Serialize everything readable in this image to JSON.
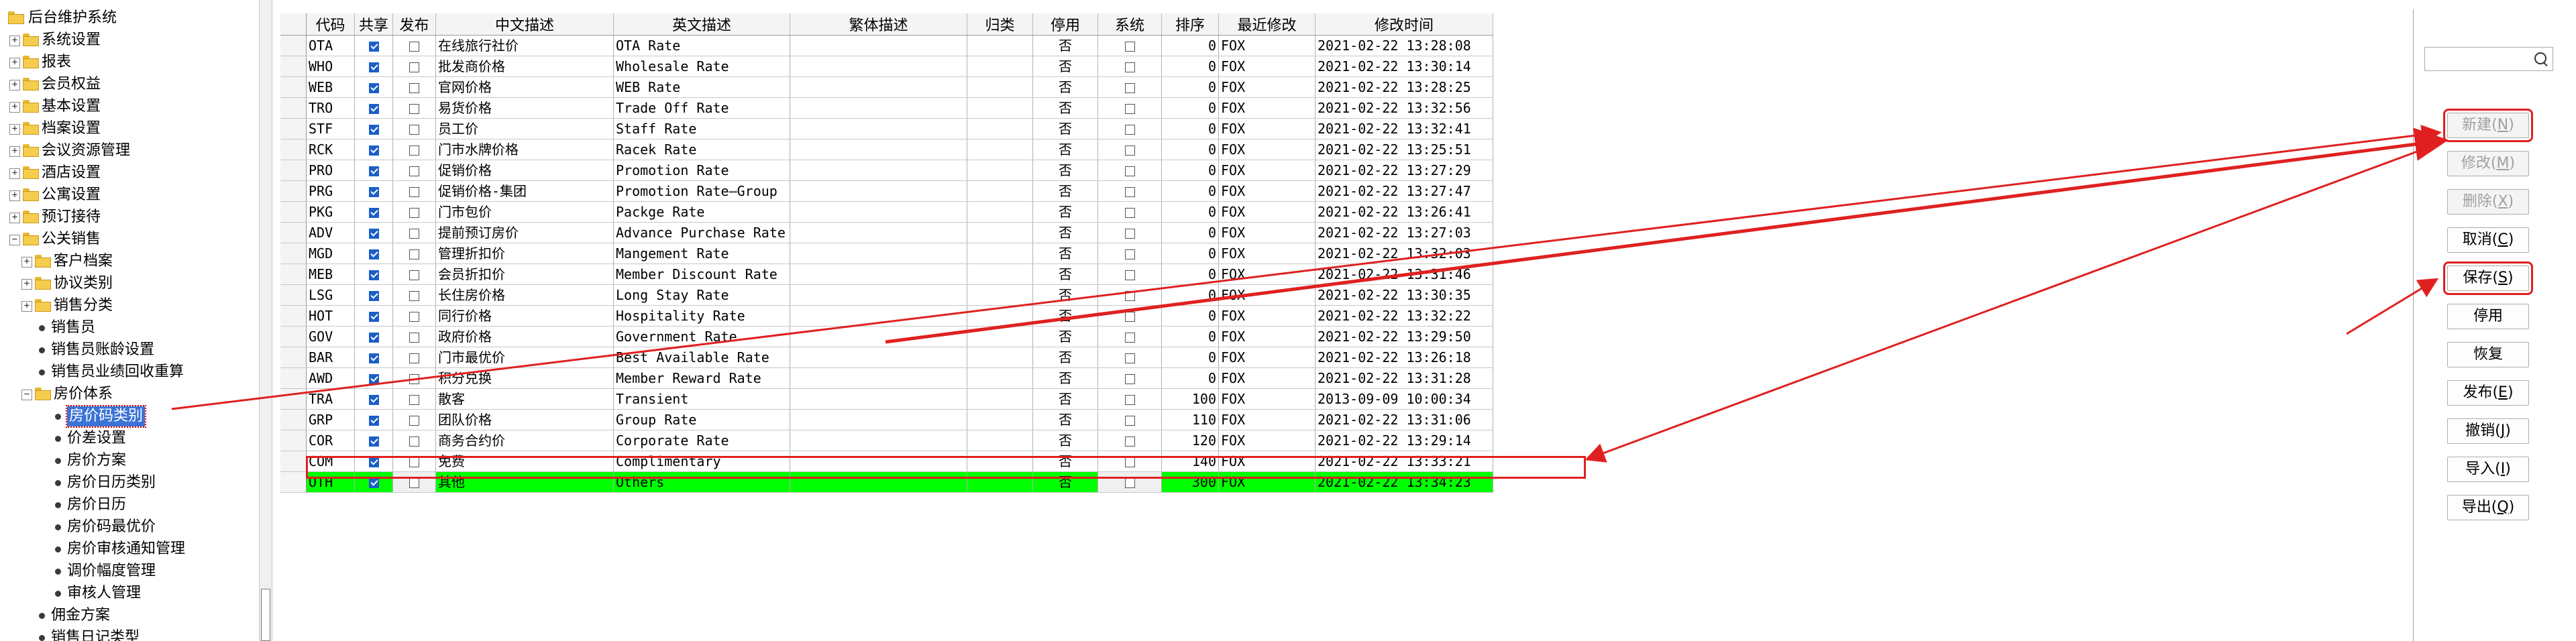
{
  "tree": {
    "items": [
      {
        "label": "后台维护系统",
        "level": 0,
        "type": "folder",
        "expander": ""
      },
      {
        "label": "系统设置",
        "level": 1,
        "type": "folder",
        "expander": "+"
      },
      {
        "label": "报表",
        "level": 1,
        "type": "folder",
        "expander": "+"
      },
      {
        "label": "会员权益",
        "level": 1,
        "type": "folder",
        "expander": "+"
      },
      {
        "label": "基本设置",
        "level": 1,
        "type": "folder",
        "expander": "+"
      },
      {
        "label": "档案设置",
        "level": 1,
        "type": "folder",
        "expander": "+"
      },
      {
        "label": "会议资源管理",
        "level": 1,
        "type": "folder",
        "expander": "+"
      },
      {
        "label": "酒店设置",
        "level": 1,
        "type": "folder",
        "expander": "+"
      },
      {
        "label": "公寓设置",
        "level": 1,
        "type": "folder",
        "expander": "+"
      },
      {
        "label": "预订接待",
        "level": 1,
        "type": "folder",
        "expander": "+"
      },
      {
        "label": "公关销售",
        "level": 1,
        "type": "folder",
        "expander": "-"
      },
      {
        "label": "客户档案",
        "level": 2,
        "type": "folder",
        "expander": "+"
      },
      {
        "label": "协议类别",
        "level": 2,
        "type": "folder",
        "expander": "+"
      },
      {
        "label": "销售分类",
        "level": 2,
        "type": "folder",
        "expander": "+"
      },
      {
        "label": "销售员",
        "level": 2,
        "type": "leaf",
        "expander": ""
      },
      {
        "label": "销售员账龄设置",
        "level": 2,
        "type": "leaf",
        "expander": ""
      },
      {
        "label": "销售员业绩回收重算",
        "level": 2,
        "type": "leaf",
        "expander": ""
      },
      {
        "label": "房价体系",
        "level": 2,
        "type": "folder",
        "expander": "-"
      },
      {
        "label": "房价码类别",
        "level": 3,
        "type": "leaf",
        "expander": "",
        "selected": true
      },
      {
        "label": "价差设置",
        "level": 3,
        "type": "leaf",
        "expander": ""
      },
      {
        "label": "房价方案",
        "level": 3,
        "type": "leaf",
        "expander": ""
      },
      {
        "label": "房价日历类别",
        "level": 3,
        "type": "leaf",
        "expander": ""
      },
      {
        "label": "房价日历",
        "level": 3,
        "type": "leaf",
        "expander": ""
      },
      {
        "label": "房价码最优价",
        "level": 3,
        "type": "leaf",
        "expander": ""
      },
      {
        "label": "房价审核通知管理",
        "level": 3,
        "type": "leaf",
        "expander": ""
      },
      {
        "label": "调价幅度管理",
        "level": 3,
        "type": "leaf",
        "expander": ""
      },
      {
        "label": "审核人管理",
        "level": 3,
        "type": "leaf",
        "expander": ""
      },
      {
        "label": "佣金方案",
        "level": 2,
        "type": "leaf",
        "expander": ""
      },
      {
        "label": "销售日记类型",
        "level": 2,
        "type": "leaf",
        "expander": ""
      }
    ]
  },
  "grid": {
    "columns": [
      "代码",
      "共享",
      "发布",
      "中文描述",
      "英文描述",
      "繁体描述",
      "归类",
      "停用",
      "系统",
      "排序",
      "最近修改",
      "修改时间"
    ],
    "rows": [
      {
        "code": "OTA",
        "share": true,
        "publish": false,
        "cn": "在线旅行社价",
        "en": "OTA Rate",
        "tw": "",
        "cat": "",
        "halt": "否",
        "sys": false,
        "sort": "0",
        "mod": "FOX",
        "time": "2021-02-22 13:28:08"
      },
      {
        "code": "WHO",
        "share": true,
        "publish": false,
        "cn": "批发商价格",
        "en": "Wholesale Rate",
        "tw": "",
        "cat": "",
        "halt": "否",
        "sys": false,
        "sort": "0",
        "mod": "FOX",
        "time": "2021-02-22 13:30:14"
      },
      {
        "code": "WEB",
        "share": true,
        "publish": false,
        "cn": "官网价格",
        "en": "WEB Rate",
        "tw": "",
        "cat": "",
        "halt": "否",
        "sys": false,
        "sort": "0",
        "mod": "FOX",
        "time": "2021-02-22 13:28:25"
      },
      {
        "code": "TRO",
        "share": true,
        "publish": false,
        "cn": "易货价格",
        "en": "Trade Off Rate",
        "tw": "",
        "cat": "",
        "halt": "否",
        "sys": false,
        "sort": "0",
        "mod": "FOX",
        "time": "2021-02-22 13:32:56"
      },
      {
        "code": "STF",
        "share": true,
        "publish": false,
        "cn": "员工价",
        "en": "Staff Rate",
        "tw": "",
        "cat": "",
        "halt": "否",
        "sys": false,
        "sort": "0",
        "mod": "FOX",
        "time": "2021-02-22 13:32:41"
      },
      {
        "code": "RCK",
        "share": true,
        "publish": false,
        "cn": "门市水牌价格",
        "en": "Racek Rate",
        "tw": "",
        "cat": "",
        "halt": "否",
        "sys": false,
        "sort": "0",
        "mod": "FOX",
        "time": "2021-02-22 13:25:51"
      },
      {
        "code": "PRO",
        "share": true,
        "publish": false,
        "cn": "促销价格",
        "en": "Promotion Rate",
        "tw": "",
        "cat": "",
        "halt": "否",
        "sys": false,
        "sort": "0",
        "mod": "FOX",
        "time": "2021-02-22 13:27:29"
      },
      {
        "code": "PRG",
        "share": true,
        "publish": false,
        "cn": "促销价格-集团",
        "en": "Promotion Rate—Group",
        "tw": "",
        "cat": "",
        "halt": "否",
        "sys": false,
        "sort": "0",
        "mod": "FOX",
        "time": "2021-02-22 13:27:47"
      },
      {
        "code": "PKG",
        "share": true,
        "publish": false,
        "cn": "门市包价",
        "en": "Packge Rate",
        "tw": "",
        "cat": "",
        "halt": "否",
        "sys": false,
        "sort": "0",
        "mod": "FOX",
        "time": "2021-02-22 13:26:41"
      },
      {
        "code": "ADV",
        "share": true,
        "publish": false,
        "cn": "提前预订房价",
        "en": "Advance Purchase Rate",
        "tw": "",
        "cat": "",
        "halt": "否",
        "sys": false,
        "sort": "0",
        "mod": "FOX",
        "time": "2021-02-22 13:27:03"
      },
      {
        "code": "MGD",
        "share": true,
        "publish": false,
        "cn": "管理折扣价",
        "en": "Mangement Rate",
        "tw": "",
        "cat": "",
        "halt": "否",
        "sys": false,
        "sort": "0",
        "mod": "FOX",
        "time": "2021-02-22 13:32:03"
      },
      {
        "code": "MEB",
        "share": true,
        "publish": false,
        "cn": "会员折扣价",
        "en": "Member Discount Rate",
        "tw": "",
        "cat": "",
        "halt": "否",
        "sys": false,
        "sort": "0",
        "mod": "FOX",
        "time": "2021-02-22 13:31:46"
      },
      {
        "code": "LSG",
        "share": true,
        "publish": false,
        "cn": "长住房价格",
        "en": "Long Stay Rate",
        "tw": "",
        "cat": "",
        "halt": "否",
        "sys": false,
        "sort": "0",
        "mod": "FOX",
        "time": "2021-02-22 13:30:35"
      },
      {
        "code": "HOT",
        "share": true,
        "publish": false,
        "cn": "同行价格",
        "en": "Hospitality Rate",
        "tw": "",
        "cat": "",
        "halt": "否",
        "sys": false,
        "sort": "0",
        "mod": "FOX",
        "time": "2021-02-22 13:32:22"
      },
      {
        "code": "GOV",
        "share": true,
        "publish": false,
        "cn": "政府价格",
        "en": "Government Rate",
        "tw": "",
        "cat": "",
        "halt": "否",
        "sys": false,
        "sort": "0",
        "mod": "FOX",
        "time": "2021-02-22 13:29:50"
      },
      {
        "code": "BAR",
        "share": true,
        "publish": false,
        "cn": "门市最优价",
        "en": "Best Available Rate",
        "tw": "",
        "cat": "",
        "halt": "否",
        "sys": false,
        "sort": "0",
        "mod": "FOX",
        "time": "2021-02-22 13:26:18"
      },
      {
        "code": "AWD",
        "share": true,
        "publish": false,
        "cn": "积分兑换",
        "en": "Member Reward Rate",
        "tw": "",
        "cat": "",
        "halt": "否",
        "sys": false,
        "sort": "0",
        "mod": "FOX",
        "time": "2021-02-22 13:31:28"
      },
      {
        "code": "TRA",
        "share": true,
        "publish": false,
        "cn": "散客",
        "en": "Transient",
        "tw": "",
        "cat": "",
        "halt": "否",
        "sys": false,
        "sort": "100",
        "mod": "FOX",
        "time": "2013-09-09 10:00:34"
      },
      {
        "code": "GRP",
        "share": true,
        "publish": false,
        "cn": "团队价格",
        "en": "Group Rate",
        "tw": "",
        "cat": "",
        "halt": "否",
        "sys": false,
        "sort": "110",
        "mod": "FOX",
        "time": "2021-02-22 13:31:06"
      },
      {
        "code": "COR",
        "share": true,
        "publish": false,
        "cn": "商务合约价",
        "en": "Corporate Rate",
        "tw": "",
        "cat": "",
        "halt": "否",
        "sys": false,
        "sort": "120",
        "mod": "FOX",
        "time": "2021-02-22 13:29:14"
      },
      {
        "code": "COM",
        "share": true,
        "publish": false,
        "cn": "免费",
        "en": "Complimentary",
        "tw": "",
        "cat": "",
        "halt": "否",
        "sys": false,
        "sort": "140",
        "mod": "FOX",
        "time": "2021-02-22 13:33:21"
      },
      {
        "code": "OTH",
        "share": true,
        "publish": false,
        "cn": "其他",
        "en": "Others",
        "tw": "",
        "cat": "",
        "halt": "否",
        "sys": false,
        "sort": "300",
        "mod": "FOX",
        "time": "2021-02-22 13:34:23",
        "new": true
      }
    ]
  },
  "search": {
    "value": "",
    "placeholder": ""
  },
  "buttons": [
    {
      "label": "新建",
      "key": "N",
      "disabled": true,
      "highlight": true
    },
    {
      "label": "修改",
      "key": "M",
      "disabled": true,
      "highlight": false
    },
    {
      "label": "删除",
      "key": "X",
      "disabled": true,
      "highlight": false
    },
    {
      "label": "取消",
      "key": "C",
      "disabled": false,
      "highlight": false
    },
    {
      "label": "保存",
      "key": "S",
      "disabled": false,
      "highlight": true
    },
    {
      "label": "停用",
      "key": "",
      "disabled": false,
      "highlight": false
    },
    {
      "label": "恢复",
      "key": "",
      "disabled": false,
      "highlight": false
    },
    {
      "label": "发布",
      "key": "E",
      "disabled": false,
      "highlight": false
    },
    {
      "label": "撤销",
      "key": "J",
      "disabled": false,
      "highlight": false
    },
    {
      "label": "导入",
      "key": "I",
      "disabled": false,
      "highlight": false
    },
    {
      "label": "导出",
      "key": "Q",
      "disabled": false,
      "highlight": false
    }
  ],
  "colors": {
    "annotation": "#e02020",
    "new_row": "#00ff00",
    "selection": "#3b73d6",
    "check": "#1a5fc8"
  }
}
